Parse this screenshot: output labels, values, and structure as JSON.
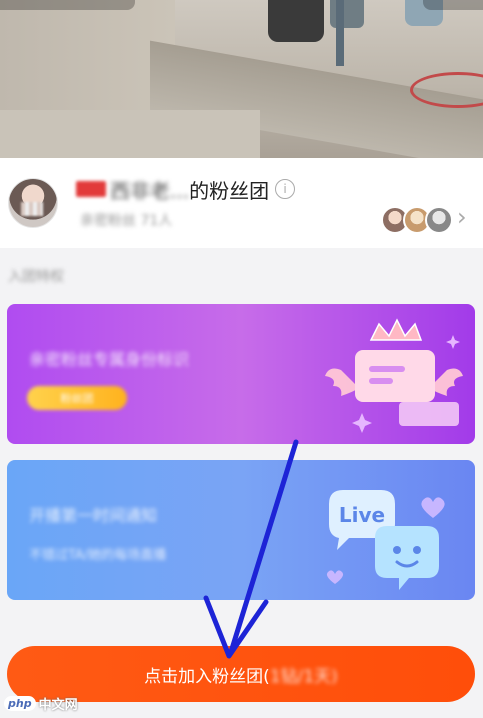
{
  "header": {
    "title_prefix": "西非老...",
    "title_suffix": "的粉丝团",
    "fan_count": "亲密粉丝 71人"
  },
  "section": {
    "label": "入团特权"
  },
  "benefits": [
    {
      "title": "亲密粉丝专属身份标识",
      "pill": "粉丝团"
    },
    {
      "title": "开播第一时间通知",
      "subtitle": "不错过TA/她的每场直播",
      "badge_text": "Live"
    }
  ],
  "join_button": {
    "label": "点击加入粉丝团(",
    "price": "1钻/1天)"
  },
  "watermark": {
    "text_en": "php",
    "text_zh": "中文网"
  },
  "colors": {
    "accent": "#ff5014",
    "card1": "#b04cf0",
    "card2": "#6aa6f7",
    "arrow": "#1d24d6"
  },
  "icons": {
    "info": "info-icon",
    "chevron": "chevron-right-icon",
    "crown": "crown-icon",
    "chat_live": "live-chat-icon",
    "arrow": "annotation-arrow-icon"
  }
}
